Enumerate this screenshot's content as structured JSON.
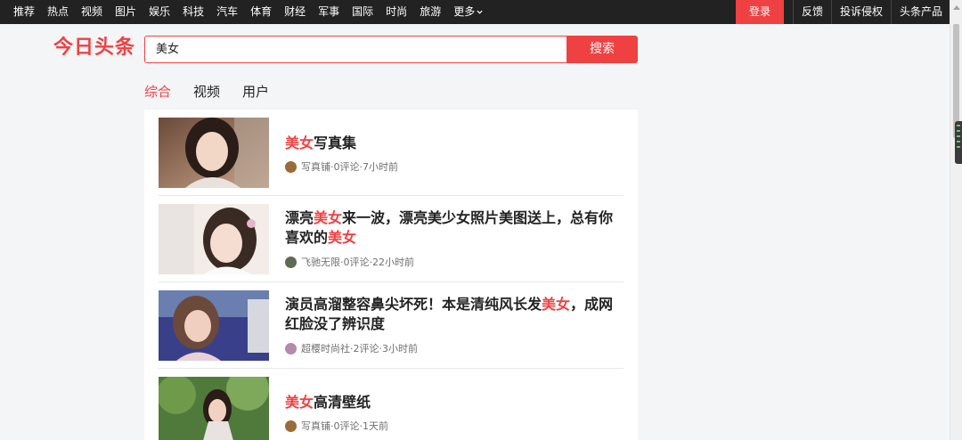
{
  "topnav": {
    "items": [
      "推荐",
      "热点",
      "视频",
      "图片",
      "娱乐",
      "科技",
      "汽车",
      "体育",
      "财经",
      "军事",
      "国际",
      "时尚",
      "旅游"
    ],
    "more": "更多",
    "login": "登录",
    "right": [
      "反馈",
      "投诉侵权",
      "头条产品"
    ]
  },
  "header": {
    "logo": "今日头条"
  },
  "search": {
    "value": "美女",
    "button": "搜索"
  },
  "tabs": [
    "综合",
    "视频",
    "用户"
  ],
  "results": [
    {
      "title_parts": [
        [
          "美女",
          true
        ],
        [
          "写真集",
          false
        ]
      ],
      "author": "写真铺",
      "comments": "0评论",
      "time": "7小时前",
      "avatar_color": "#9a6a3a"
    },
    {
      "title_parts": [
        [
          "漂亮",
          false
        ],
        [
          "美女",
          true
        ],
        [
          "来一波，漂亮美少女照片美图送上，总有你喜欢的",
          false
        ],
        [
          "美女",
          true
        ]
      ],
      "author": "飞驰无限",
      "comments": "0评论",
      "time": "22小时前",
      "avatar_color": "#5c6b52"
    },
    {
      "title_parts": [
        [
          "演员高溜整容鼻尖坏死！本是清纯风长发",
          false
        ],
        [
          "美女",
          true
        ],
        [
          "，成网红脸没了辨识度",
          false
        ]
      ],
      "author": "超樱时尚社",
      "comments": "2评论",
      "time": "3小时前",
      "avatar_color": "#b48aa8"
    },
    {
      "title_parts": [
        [
          "美女",
          true
        ],
        [
          "高清壁纸",
          false
        ]
      ],
      "author": "写真铺",
      "comments": "0评论",
      "time": "1天前",
      "avatar_color": "#9a6a3a"
    }
  ],
  "meta_sep": " · "
}
